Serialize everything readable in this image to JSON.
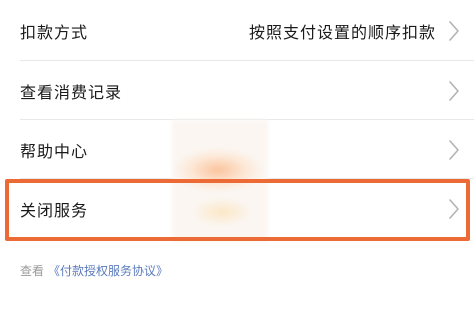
{
  "menu": {
    "items": [
      {
        "label": "扣款方式",
        "value": "按照支付设置的顺序扣款",
        "chevron_icon": "chevron-right-icon"
      },
      {
        "label": "查看消费记录",
        "chevron_icon": "chevron-right-icon"
      },
      {
        "label": "帮助中心",
        "chevron_icon": "chevron-right-icon"
      },
      {
        "label": "关闭服务",
        "chevron_icon": "chevron-right-icon"
      }
    ]
  },
  "highlight": {
    "color": "#ec6a36"
  },
  "footer": {
    "prefix": "查看",
    "link": "《付款授权服务协议》"
  },
  "colors": {
    "text": "#1a1a1a",
    "link": "#5b7bbd",
    "muted": "#999999"
  }
}
